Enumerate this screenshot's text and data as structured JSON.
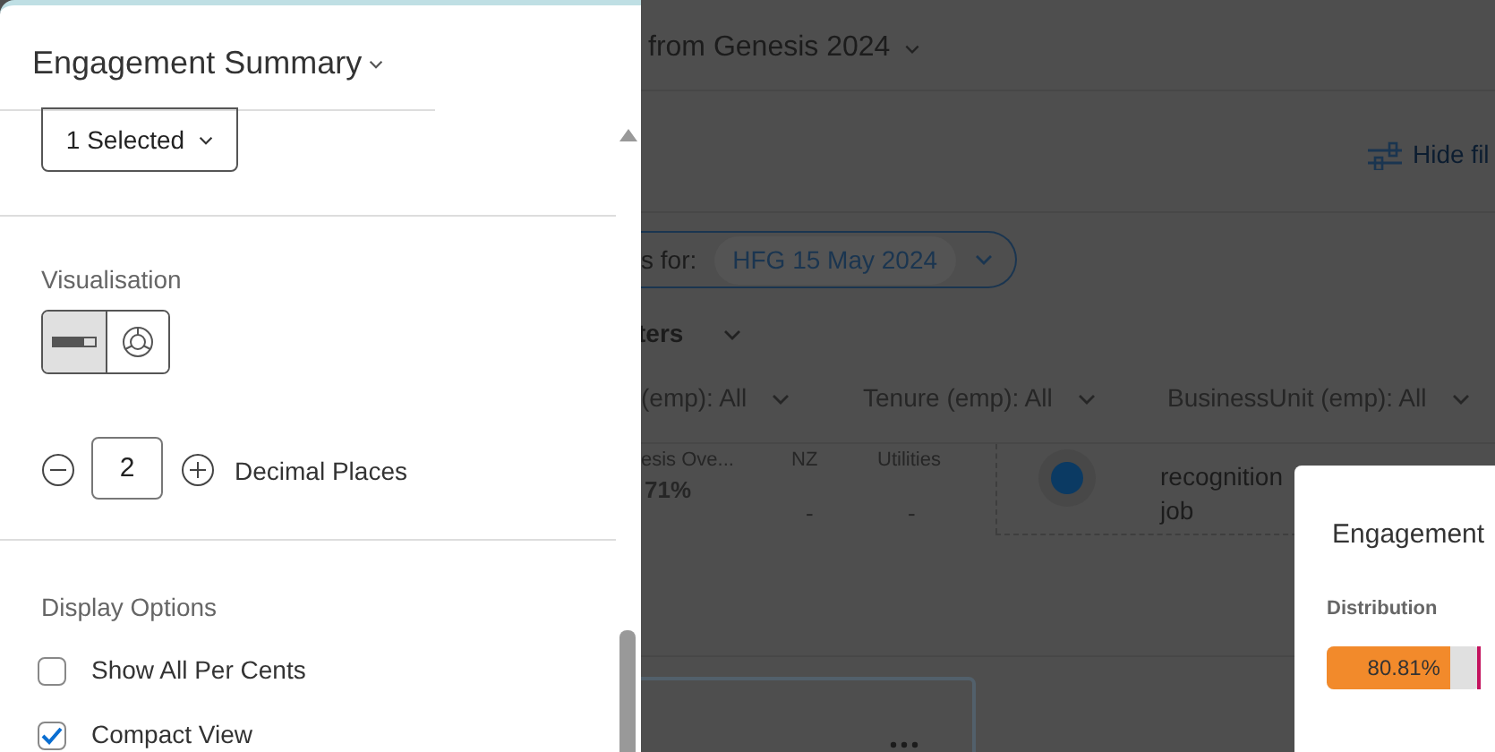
{
  "panel": {
    "title": "Engagement Summary",
    "dropdown": "1 Selected",
    "visualisation": {
      "label": "Visualisation",
      "options": [
        {
          "kind": "bar",
          "selected": true
        },
        {
          "kind": "donut",
          "selected": false
        }
      ]
    },
    "decimal": {
      "value": "2",
      "label": "Decimal Places"
    },
    "display_options": {
      "label": "Display Options",
      "items": [
        {
          "label": "Show All Per Cents",
          "checked": false
        },
        {
          "label": "Compact View",
          "checked": true
        }
      ]
    }
  },
  "background": {
    "title": "from Genesis 2024",
    "hide_filters": "Hide fil",
    "results_for": "s for:",
    "date_chip": "HFG 15 May 2024",
    "filters_heading": "ters",
    "filters": [
      "(emp): All",
      "Tenure (emp): All",
      "BusinessUnit (emp): All"
    ],
    "row": {
      "columns": [
        {
          "header": "esis Ove...",
          "value": "71%"
        },
        {
          "header": "NZ",
          "value": "-"
        },
        {
          "header": "Utilities",
          "value": "-"
        }
      ],
      "text_lines": [
        "recognition",
        "job"
      ]
    }
  },
  "popup": {
    "title": "Engagement",
    "column_1": "Distribution",
    "bar": {
      "level": 0.8081,
      "reading": "80.81%"
    }
  }
}
